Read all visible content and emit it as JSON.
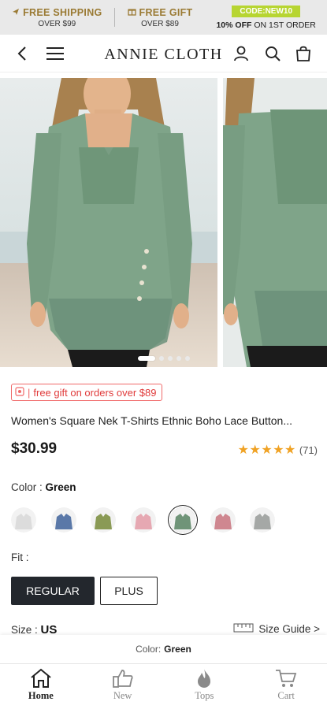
{
  "promo": {
    "shipping_title": "FREE SHIPPING",
    "shipping_sub": "OVER $99",
    "gift_title": "FREE GIFT",
    "gift_sub": "OVER $89",
    "code_badge": "CODE:NEW10",
    "code_offer_bold": "10% OFF",
    "code_offer_rest": " ON 1ST ORDER"
  },
  "header": {
    "brand": "ANNIE CLOTH",
    "back_icon": "chevron-left-icon",
    "menu_icon": "hamburger-icon",
    "account_icon": "user-icon",
    "search_icon": "search-icon",
    "bag_icon": "shopping-bag-icon"
  },
  "gallery": {
    "slide_count": 5,
    "active_index": 0
  },
  "product": {
    "gift_tag": "free gift on orders over $89",
    "title": "Women's Square Nek T-Shirts Ethnic Boho Lace Button...",
    "price": "$30.99",
    "rating": 5,
    "review_count": "(71)"
  },
  "color": {
    "label": "Color :",
    "selected": "Green",
    "swatches": [
      {
        "name": "white-floral",
        "color": "#dcdcdc"
      },
      {
        "name": "blue",
        "color": "#5a78a8"
      },
      {
        "name": "olive",
        "color": "#8a9a55"
      },
      {
        "name": "pink",
        "color": "#e6a8b2"
      },
      {
        "name": "green",
        "color": "#6f9478",
        "selected": true
      },
      {
        "name": "rose",
        "color": "#cf8790"
      },
      {
        "name": "grey",
        "color": "#a5a8a6"
      }
    ]
  },
  "fit": {
    "label": "Fit :",
    "options": [
      "REGULAR",
      "PLUS"
    ],
    "selected": "REGULAR"
  },
  "size": {
    "label": "Size :",
    "value": "US",
    "guide": "Size Guide >"
  },
  "selection_bar": {
    "label": "Color:",
    "value": "Green"
  },
  "tabs": [
    {
      "label": "Home",
      "icon": "home-icon",
      "active": true
    },
    {
      "label": "New",
      "icon": "thumbs-up-icon",
      "active": false
    },
    {
      "label": "Tops",
      "icon": "flame-icon",
      "active": false
    },
    {
      "label": "Cart",
      "icon": "cart-icon",
      "active": false
    }
  ],
  "colors": {
    "accent_gold": "#9a7a33",
    "code_green": "#b7d531",
    "sale_red": "#e03b3b",
    "star_orange": "#f0a224",
    "dark_button": "#23272d"
  }
}
